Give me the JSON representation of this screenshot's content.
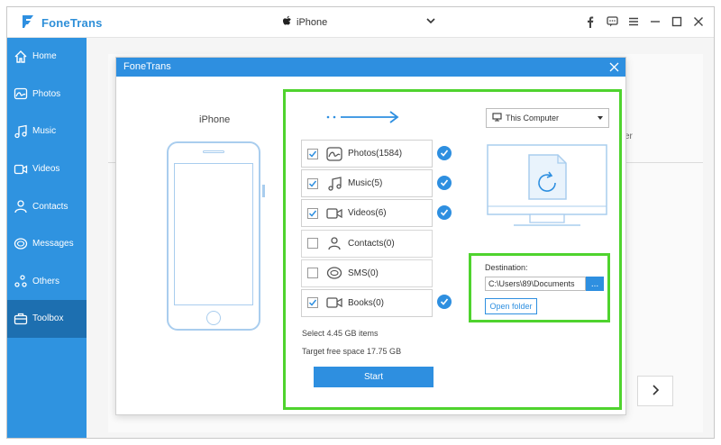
{
  "app": {
    "brand": "FoneTrans"
  },
  "device": {
    "name": "iPhone"
  },
  "sidebar": {
    "items": [
      {
        "label": "Home",
        "icon": "home-icon"
      },
      {
        "label": "Photos",
        "icon": "photos-icon"
      },
      {
        "label": "Music",
        "icon": "music-icon"
      },
      {
        "label": "Videos",
        "icon": "videos-icon"
      },
      {
        "label": "Contacts",
        "icon": "contacts-icon"
      },
      {
        "label": "Messages",
        "icon": "messages-icon"
      },
      {
        "label": "Others",
        "icon": "others-icon"
      },
      {
        "label": "Toolbox",
        "icon": "toolbox-icon",
        "active": true
      }
    ]
  },
  "background": {
    "partial_text": "er"
  },
  "modal": {
    "title": "FoneTrans",
    "source_label": "iPhone",
    "target": "This Computer",
    "items": [
      {
        "label": "Photos(1584)",
        "checked": true,
        "icon": "photo-icon"
      },
      {
        "label": "Music(5)",
        "checked": true,
        "icon": "music-note-icon"
      },
      {
        "label": "Videos(6)",
        "checked": true,
        "icon": "video-icon"
      },
      {
        "label": "Contacts(0)",
        "checked": false,
        "icon": "contact-icon"
      },
      {
        "label": "SMS(0)",
        "checked": false,
        "icon": "sms-icon"
      },
      {
        "label": "Books(0)",
        "checked": true,
        "icon": "book-icon"
      }
    ],
    "select_summary": "Select 4.45 GB items",
    "free_space": "Target free space 17.75 GB",
    "start_label": "Start",
    "destination": {
      "label": "Destination:",
      "path": "C:\\Users\\89\\Documents",
      "browse_label": "...",
      "open_folder_label": "Open folder"
    }
  },
  "colors": {
    "accent": "#2e8fe0",
    "sidebar": "#2f93e0",
    "sidebar_active": "#1d6fb0",
    "highlight": "#4fd32e"
  }
}
